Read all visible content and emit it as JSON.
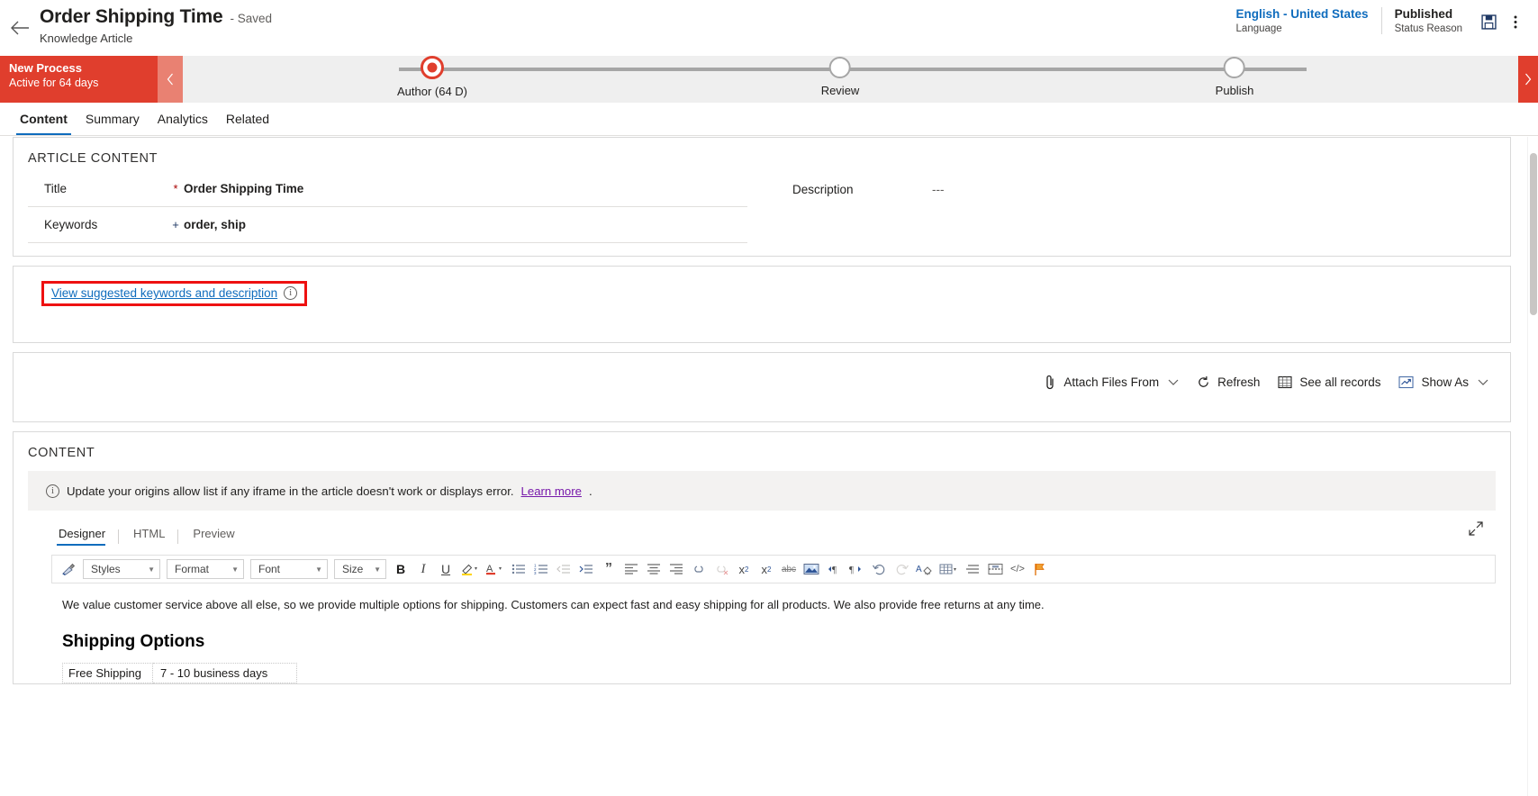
{
  "header": {
    "back_icon": "arrow-left-icon",
    "title": "Order Shipping Time",
    "saved_status": "- Saved",
    "entity": "Knowledge Article",
    "language_value": "English - United States",
    "language_label": "Language",
    "status_value": "Published",
    "status_label": "Status Reason",
    "save_icon": "save-icon",
    "more_icon": "more-vertical-icon"
  },
  "process": {
    "stage_name": "New Process",
    "stage_sub": "Active for 64 days",
    "collapse_icon": "chevron-left-icon",
    "next_icon": "chevron-right-icon",
    "stages": [
      {
        "label": "Author  (64 D)",
        "state": "active"
      },
      {
        "label": "Review",
        "state": "pending"
      },
      {
        "label": "Publish",
        "state": "pending"
      }
    ]
  },
  "tabs": [
    {
      "label": "Content",
      "active": true
    },
    {
      "label": "Summary",
      "active": false
    },
    {
      "label": "Analytics",
      "active": false
    },
    {
      "label": "Related",
      "active": false
    }
  ],
  "article_content": {
    "section_title": "ARTICLE CONTENT",
    "fields_left": [
      {
        "label": "Title",
        "required_mark": "*",
        "mark_color": "red",
        "value": "Order Shipping Time"
      },
      {
        "label": "Keywords",
        "required_mark": "+",
        "mark_color": "blue",
        "value": "order, ship"
      }
    ],
    "fields_right": [
      {
        "label": "Description",
        "required_mark": "",
        "mark_color": "none",
        "value": "---"
      }
    ]
  },
  "suggestions": {
    "link_text": "View suggested keywords and description",
    "info_icon": "info-circle-icon",
    "info_glyph": "i",
    "highlight_color": "#ee1111"
  },
  "attachments": {
    "commands": [
      {
        "label": "Attach Files From",
        "icon": "paperclip-icon",
        "has_chevron": true
      },
      {
        "label": "Refresh",
        "icon": "refresh-icon",
        "has_chevron": false
      },
      {
        "label": "See all records",
        "icon": "grid-icon",
        "has_chevron": false
      },
      {
        "label": "Show As",
        "icon": "chart-view-icon",
        "has_chevron": true
      }
    ],
    "chevron_glyph": "⌄"
  },
  "content_section": {
    "section_title": "CONTENT",
    "notice_icon": "info-circle-icon",
    "notice_text": "Update your origins allow list if any iframe in the article doesn't work or displays error.",
    "notice_link": "Learn more",
    "notice_suffix": ".",
    "editor_tabs": [
      {
        "label": "Designer",
        "active": true
      },
      {
        "label": "HTML",
        "active": false
      },
      {
        "label": "Preview",
        "active": false
      }
    ],
    "expand_icon": "expand-diagonal-icon"
  },
  "editor_toolbar": {
    "format_painter_icon": "format-painter-icon",
    "selects": [
      {
        "name": "styles",
        "label": "Styles"
      },
      {
        "name": "format",
        "label": "Format"
      },
      {
        "name": "font",
        "label": "Font"
      },
      {
        "name": "size",
        "label": "Size"
      }
    ],
    "buttons": [
      {
        "name": "bold-button",
        "glyph": "B"
      },
      {
        "name": "italic-button",
        "glyph": "I"
      },
      {
        "name": "underline-button",
        "glyph": "U"
      },
      {
        "name": "text-highlight-button",
        "glyph": "✎"
      },
      {
        "name": "font-color-button",
        "glyph": "A"
      },
      {
        "name": "bulleted-list-button",
        "glyph": "≡"
      },
      {
        "name": "numbered-list-button",
        "glyph": "≣"
      },
      {
        "name": "decrease-indent-button",
        "glyph": "←"
      },
      {
        "name": "increase-indent-button",
        "glyph": "→"
      },
      {
        "name": "block-quote-button",
        "glyph": "”"
      },
      {
        "name": "align-left-button",
        "glyph": "≡"
      },
      {
        "name": "align-center-button",
        "glyph": "≡"
      },
      {
        "name": "align-right-button",
        "glyph": "≡"
      },
      {
        "name": "insert-link-button",
        "glyph": "⚭"
      },
      {
        "name": "unlink-button",
        "glyph": "⚭"
      },
      {
        "name": "superscript-button",
        "glyph": "x²"
      },
      {
        "name": "subscript-button",
        "glyph": "x₂"
      },
      {
        "name": "strikethrough-button",
        "glyph": "abc"
      },
      {
        "name": "insert-image-button",
        "glyph": "⛰"
      },
      {
        "name": "text-direction-ltr-button",
        "glyph": "¶"
      },
      {
        "name": "text-direction-rtl-button",
        "glyph": "¶"
      },
      {
        "name": "undo-button",
        "glyph": "↶"
      },
      {
        "name": "redo-button",
        "glyph": "↷"
      },
      {
        "name": "remove-format-button",
        "glyph": "A"
      },
      {
        "name": "insert-table-button",
        "glyph": "⊞"
      },
      {
        "name": "horizontal-rule-button",
        "glyph": "≡"
      },
      {
        "name": "page-break-button",
        "glyph": "⌸"
      },
      {
        "name": "source-code-button",
        "glyph": "</>"
      },
      {
        "name": "flag-button",
        "glyph": "⚑"
      }
    ]
  },
  "article_body": {
    "paragraph": "We value customer service above all else, so we provide multiple options for shipping. Customers can expect fast and easy shipping for all products. We also provide free returns at any time.",
    "heading": "Shipping Options",
    "table_rows": [
      {
        "option": "Free Shipping",
        "duration": "7 - 10 business days"
      }
    ]
  }
}
